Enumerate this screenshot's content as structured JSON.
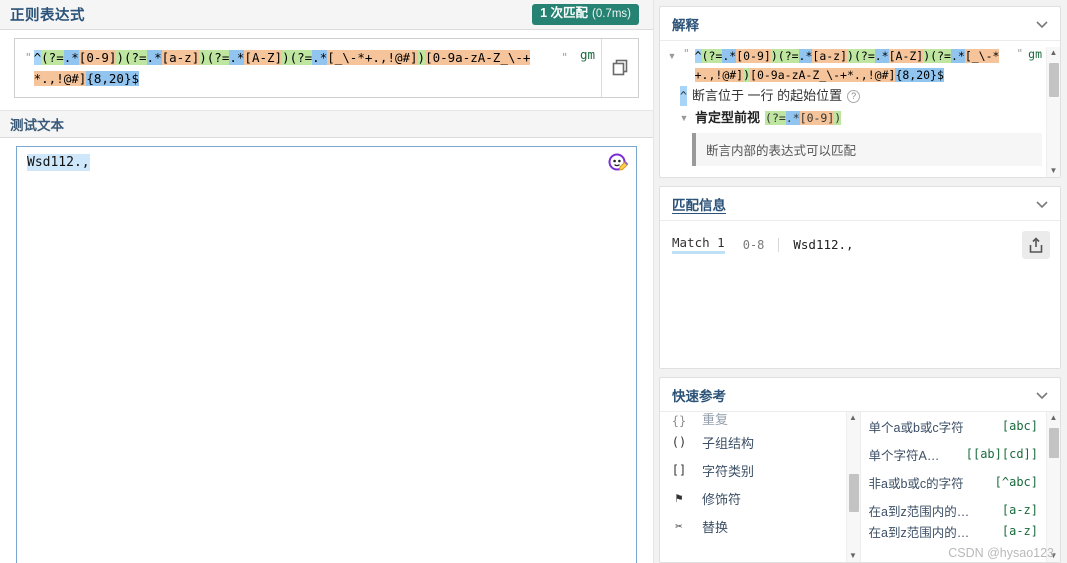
{
  "left": {
    "regex_header_title": "正则表达式",
    "match_badge": {
      "count_label": "1 次匹配",
      "time_label": "(0.7ms)",
      "color": "#268272"
    },
    "regex_delimiter": "\"",
    "regex_pattern": "^(?=.*[0-9])(?=.*[a-z])(?=.*[A-Z])(?=.*[_\\-*+.,!@#])[0-9a-zA-Z_\\-+*.,!@#]{8,20}$",
    "flags": "gm",
    "copy_icon": "copy-icon",
    "test_header_title": "测试文本",
    "test_text": "Wsd112.,",
    "avatar_icon": "avatar-pencil-icon"
  },
  "explain": {
    "title": "解释",
    "collapse_icon": "chevron-down-icon",
    "regex_delimiter": "\"",
    "regex_pattern": "^(?=.*[0-9])(?=.*[a-z])(?=.*[A-Z])(?=.*[_\\-*+.,!@#])[0-9a-zA-Z_\\-+*.,!@#]{8,20}$",
    "flags": "gm",
    "rows": [
      {
        "token": "^",
        "text": "断言位于 一行 的起始位置",
        "help": "?"
      },
      {
        "label": "肯定型前视",
        "token": "(?=.*[0-9])"
      }
    ],
    "note": "断言内部的表达式可以匹配"
  },
  "match_info": {
    "title": "匹配信息",
    "collapse_icon": "chevron-down-icon",
    "export_icon": "export-icon",
    "rows": [
      {
        "label": "Match 1",
        "range": "0-8",
        "text": "Wsd112.,"
      }
    ]
  },
  "quick_ref": {
    "title": "快速参考",
    "collapse_icon": "chevron-down-icon",
    "left_items": [
      {
        "icon": "{}",
        "label": "重复",
        "cut": true
      },
      {
        "icon": "()",
        "label": "子组结构"
      },
      {
        "icon": "[]",
        "label": "字符类别"
      },
      {
        "icon": "⚑",
        "label": "修饰符"
      },
      {
        "icon": "✂",
        "label": "替换"
      }
    ],
    "right_items": [
      {
        "label": "单个a或b或c字符",
        "code": "[abc]"
      },
      {
        "label": "单个字符A…",
        "code": "[[ab][cd]]"
      },
      {
        "label": "非a或b或c的字符",
        "code": "[^abc]"
      },
      {
        "label": "在a到z范围内的…",
        "code": "[a-z]"
      },
      {
        "label": "在a到z范围内的…",
        "code": "[a-z]",
        "cut": true
      }
    ],
    "watermark": "CSDN @hysao123"
  }
}
